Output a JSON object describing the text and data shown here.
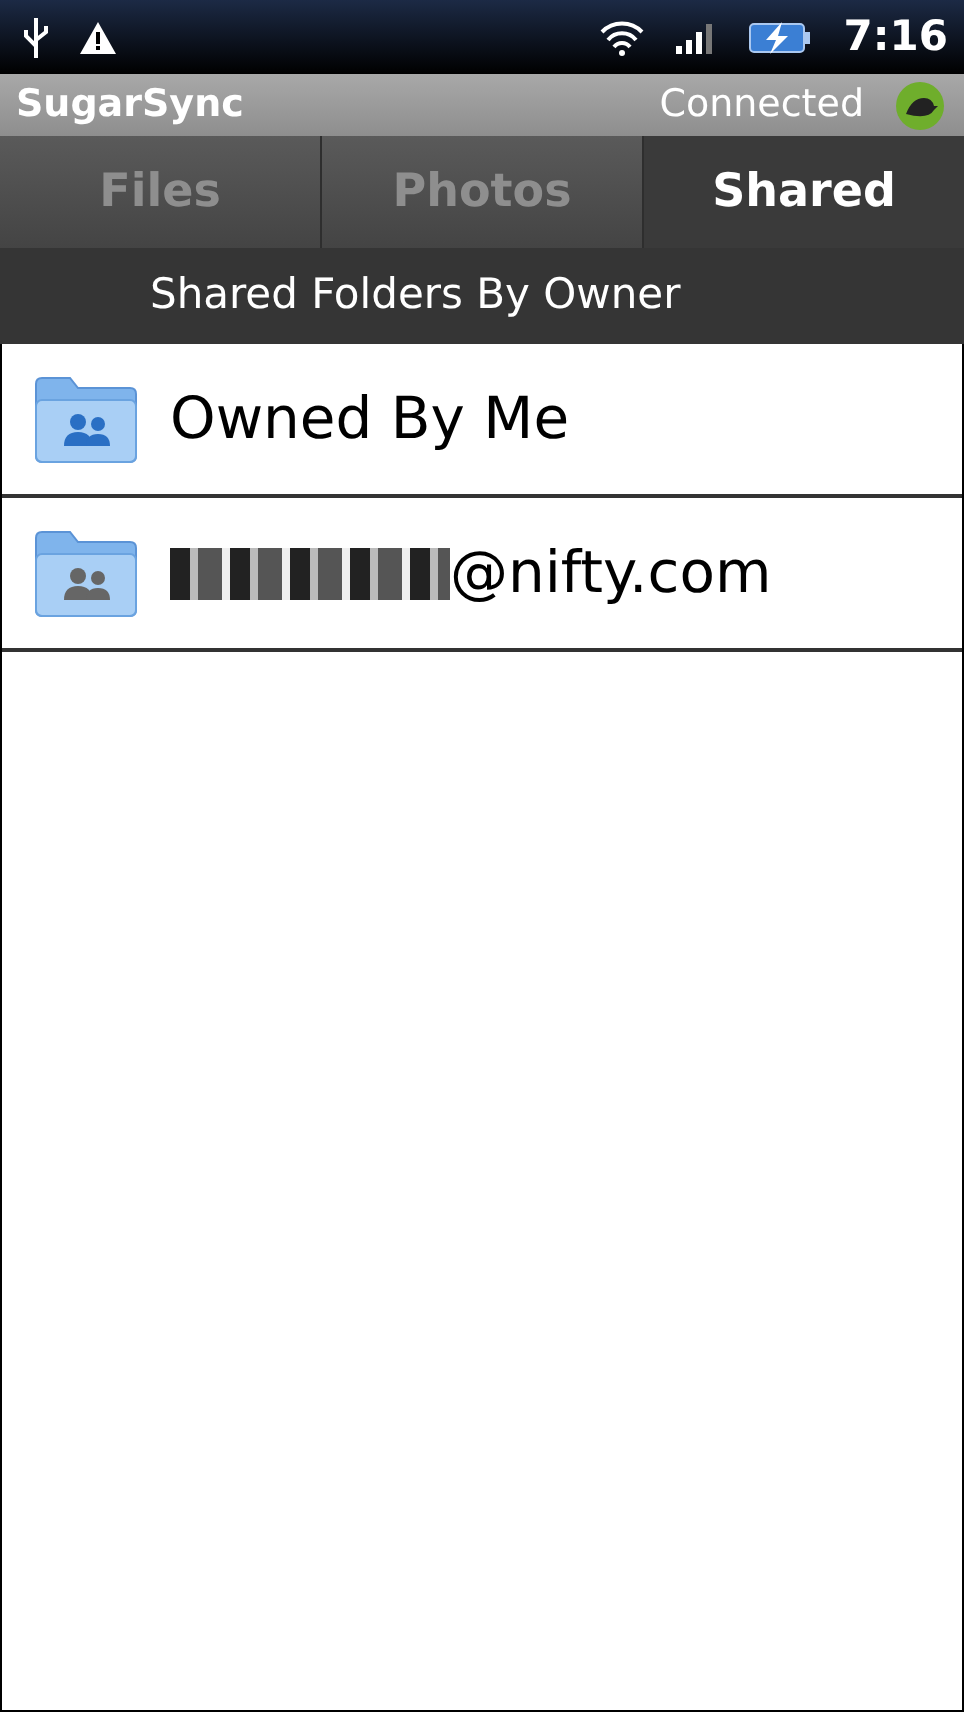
{
  "status_bar": {
    "time": "7:16"
  },
  "app_bar": {
    "title": "SugarSync",
    "status": "Connected"
  },
  "tabs": [
    {
      "label": "Files",
      "selected": false
    },
    {
      "label": "Photos",
      "selected": false
    },
    {
      "label": "Shared",
      "selected": true
    }
  ],
  "section_header": "Shared Folders By Owner",
  "folders": [
    {
      "label": "Owned By Me",
      "kind": "mine",
      "redacted": false
    },
    {
      "label": "@nifty.com",
      "kind": "other",
      "redacted": true
    }
  ]
}
